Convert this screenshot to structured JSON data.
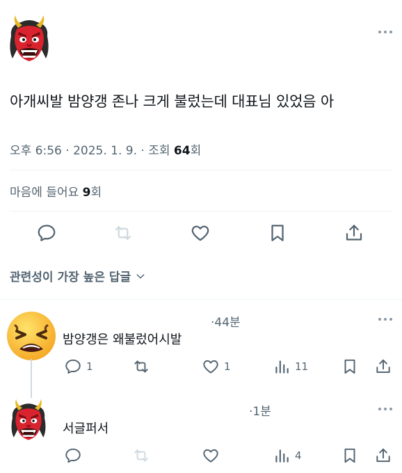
{
  "main_tweet": {
    "text": "아개씨발 밤양갱 존나 크게 불렀는데 대표님 있었음 아",
    "time": "오후 6:56 · 2025. 1. 9. · 조회 ",
    "views": "64",
    "views_suffix": "회",
    "likes_label": "마음에 들어요 ",
    "likes_count": "9",
    "likes_suffix": "회"
  },
  "sort": {
    "label": "관련성이 가장 높은 답글"
  },
  "replies": [
    {
      "time": "·44분",
      "text": "밤양갱은 왜불렀어시발",
      "reply_count": "1",
      "retweet_count": "",
      "like_count": "1",
      "view_count": "11"
    },
    {
      "time": "·1분",
      "text": "서글퍼서",
      "reply_count": "",
      "retweet_count": "",
      "like_count": "",
      "view_count": "4"
    }
  ],
  "colors": {
    "text": "#0f1419",
    "muted": "#536471",
    "divider": "#eff3f4",
    "demon_red": "#d9232e"
  },
  "icons": [
    "reply-icon",
    "retweet-icon",
    "like-icon",
    "bookmark-icon",
    "share-icon",
    "views-icon",
    "more-icon",
    "chevron-down-icon"
  ]
}
